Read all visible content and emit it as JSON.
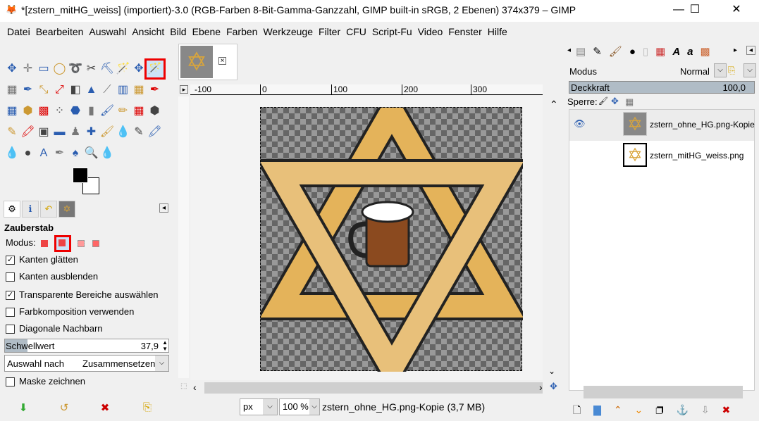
{
  "window": {
    "title": "*[zstern_mitHG_weiss] (importiert)-3.0 (RGB-Farben 8-Bit-Gamma-Ganzzahl, GIMP built-in sRGB, 2 Ebenen) 374x379 – GIMP",
    "minimize": "—",
    "maximize": "☐",
    "close": "✕"
  },
  "menu": [
    "Datei",
    "Bearbeiten",
    "Auswahl",
    "Ansicht",
    "Bild",
    "Ebene",
    "Farben",
    "Werkzeuge",
    "Filter",
    "CFU",
    "Script-Fu",
    "Video",
    "Fenster",
    "Hilfe"
  ],
  "tool_options": {
    "title": "Zauberstab",
    "mode_label": "Modus:",
    "options": [
      {
        "label": "Kanten glätten",
        "checked": true
      },
      {
        "label": "Kanten ausblenden",
        "checked": false
      },
      {
        "label": "Transparente Bereiche auswählen",
        "checked": true
      },
      {
        "label": "Farbkomposition verwenden",
        "checked": false
      },
      {
        "label": "Diagonale Nachbarn",
        "checked": false
      }
    ],
    "threshold_label": "Schwellwert",
    "threshold_value": "37,9",
    "select_by_label": "Auswahl nach",
    "select_by_value": "Zusammensetzen",
    "draw_mask_label": "Maske zeichnen",
    "draw_mask_checked": false
  },
  "ruler": {
    "h_labels": [
      "-100",
      "0",
      "100",
      "200",
      "300"
    ]
  },
  "status": {
    "unit": "px",
    "zoom": "100 %",
    "info": "zstern_ohne_HG.png-Kopie (3,7 MB)"
  },
  "layers_panel": {
    "mode_label": "Modus",
    "mode_value": "Normal",
    "opacity_label": "Deckkraft",
    "opacity_value": "100,0",
    "lock_label": "Sperre:",
    "layers": [
      {
        "name": "zstern_ohne_HG.png-Kopie",
        "visible": true
      },
      {
        "name": "zstern_mitHG_weiss.png",
        "visible": false
      }
    ]
  },
  "colors": {
    "accent_highlight": "#e00000",
    "star_gold": "#d9a53b"
  }
}
